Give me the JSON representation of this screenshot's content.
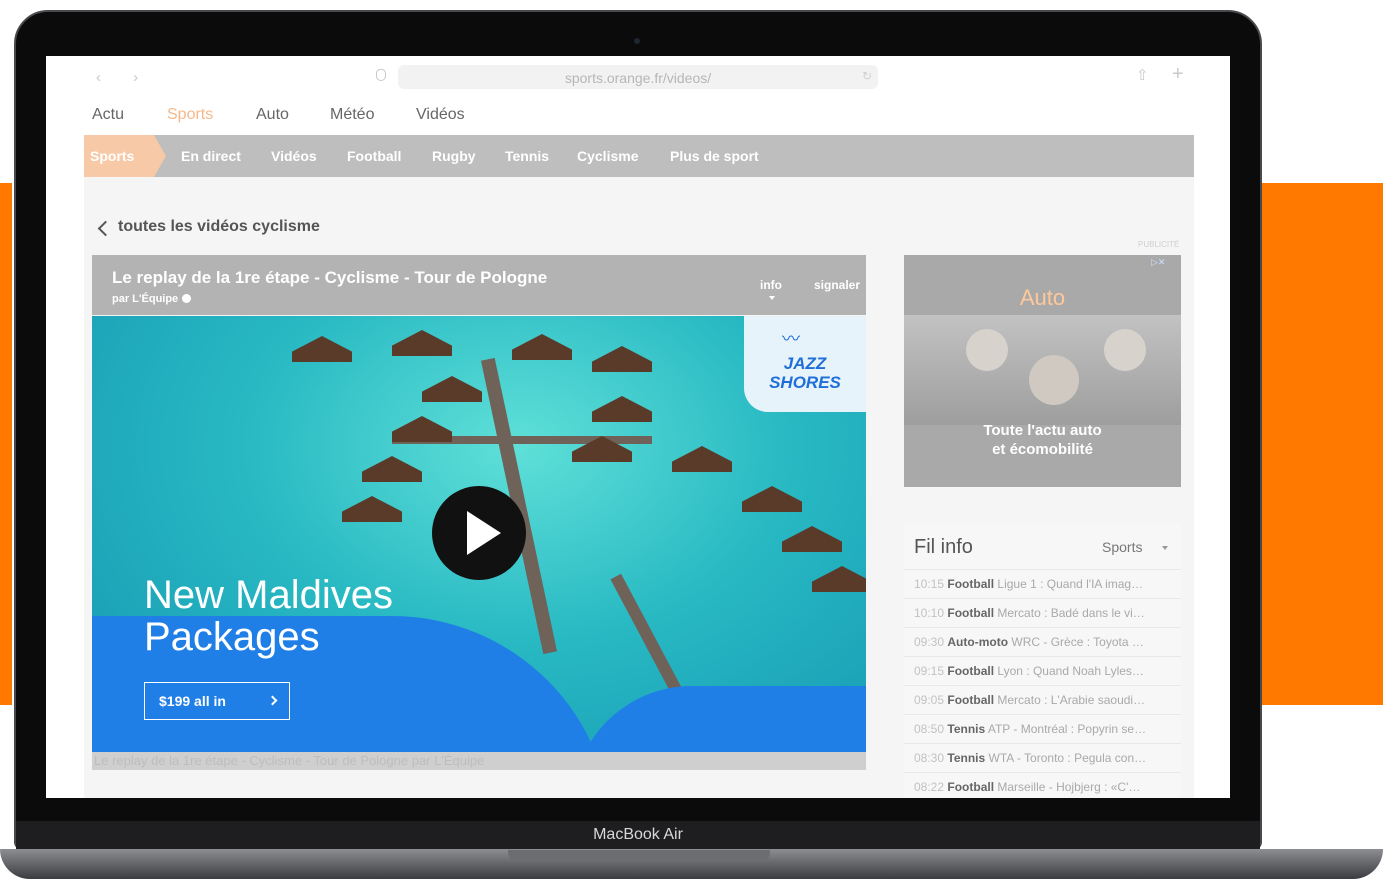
{
  "browser": {
    "nav_arrows": "‹  ›",
    "url": "sports.orange.fr/videos/"
  },
  "top_nav": [
    "Actu",
    "Sports",
    "Auto",
    "Météo",
    "Vidéos"
  ],
  "subnav": {
    "home": "Sports",
    "items": [
      "En direct",
      "Vidéos",
      "Football",
      "Rugby",
      "Tennis",
      "Cyclisme",
      "Plus de sport"
    ]
  },
  "back_link": "toutes les vidéos cyclisme",
  "pub_label": "PUBLICITÉ",
  "video": {
    "title": "Le replay de la 1re étape - Cyclisme - Tour de Pologne",
    "byline": "par L'Équipe",
    "info": "info",
    "signal": "signaler",
    "caption": "Le replay de la 1re étape - Cyclisme - Tour de Pologne par L'Équipe",
    "ad": {
      "brand": "JAZZ\nSHORES",
      "headline": "New Maldives\nPackages",
      "cta": "$199 all in"
    }
  },
  "side_ad": {
    "title": "Auto",
    "text": "Toute l'actu auto\net écomobilité"
  },
  "fil_info": {
    "title": "Fil info",
    "filter": "Sports",
    "items": [
      {
        "time": "10:15",
        "category": "Football",
        "text": "Ligue 1 : Quand l'IA imag…"
      },
      {
        "time": "10:10",
        "category": "Football",
        "text": "Mercato : Badé dans le vi…"
      },
      {
        "time": "09:30",
        "category": "Auto-moto",
        "text": "WRC - Grèce : Toyota …"
      },
      {
        "time": "09:15",
        "category": "Football",
        "text": "Lyon : Quand Noah Lyles…"
      },
      {
        "time": "09:05",
        "category": "Football",
        "text": "Mercato : L'Arabie saoudi…"
      },
      {
        "time": "08:50",
        "category": "Tennis",
        "text": "ATP - Montréal : Popyrin se…"
      },
      {
        "time": "08:30",
        "category": "Tennis",
        "text": "WTA - Toronto : Pegula con…"
      },
      {
        "time": "08:22",
        "category": "Football",
        "text": "Marseille - Hojbjerg : «C'…"
      }
    ]
  },
  "device_label": "MacBook Air",
  "colors": {
    "accent": "#ff7900",
    "subnav": "#bebebe",
    "ad_blue": "#1f7fe6"
  }
}
